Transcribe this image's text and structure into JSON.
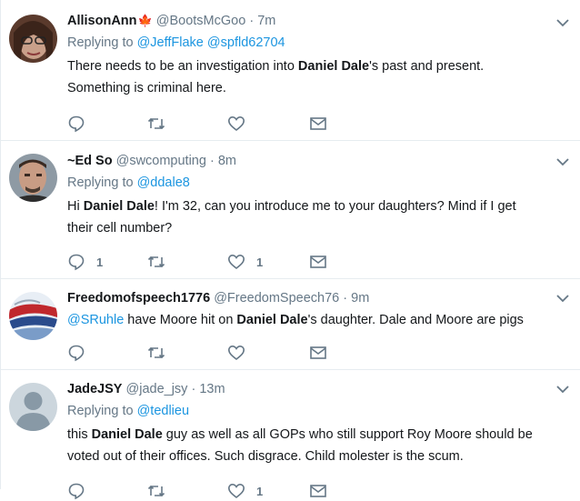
{
  "tweets": [
    {
      "name": "AllisonAnn",
      "has_flag": true,
      "flag_icon": "maple-leaf-icon",
      "handle": "@BootsMcGoo",
      "dot": "·",
      "time": "7m",
      "replying_prefix": "Replying to",
      "replying_to": [
        "@JeffFlake",
        "@spfld62704"
      ],
      "text_line1_pre": "There needs to be an investigation into ",
      "text_line1_bold": "Daniel Dale",
      "text_line1_post": "'s past and present.",
      "text_line2": "Something is criminal here.",
      "reply_count": "",
      "like_count": ""
    },
    {
      "name": "~Ed So",
      "handle": "@swcomputing",
      "dot": "·",
      "time": "8m",
      "replying_prefix": "Replying to",
      "replying_to": [
        "@ddale8"
      ],
      "text_line1_pre": "Hi ",
      "text_line1_bold": "Daniel Dale",
      "text_line1_post": "! I'm 32, can you introduce me to your daughters?  Mind if I get",
      "text_line2": "their cell number?",
      "reply_count": "1",
      "like_count": "1"
    },
    {
      "name": "Freedomofspeech1776",
      "handle": "@FreedomSpeech76",
      "dot": "·",
      "time": "9m",
      "mention": "@SRuhle",
      "text_pre": " have Moore hit on ",
      "text_bold": "Daniel Dale",
      "text_post": "'s daughter. Dale and Moore are pigs",
      "reply_count": "",
      "like_count": ""
    },
    {
      "name": "JadeJSY",
      "handle": "@jade_jsy",
      "dot": "·",
      "time": "13m",
      "replying_prefix": "Replying to",
      "replying_to": [
        "@tedlieu"
      ],
      "text_line1_pre": "this ",
      "text_line1_bold": "Daniel Dale",
      "text_line1_post": " guy as well as all GOPs who still support Roy Moore should be",
      "text_line2": "voted out of their offices. Such disgrace. Child molester is the scum.",
      "reply_count": "",
      "like_count": "1"
    }
  ],
  "colors": {
    "link": "#1b95e0",
    "muted": "#657786",
    "text": "#14171a",
    "border": "#e6ecf0"
  }
}
